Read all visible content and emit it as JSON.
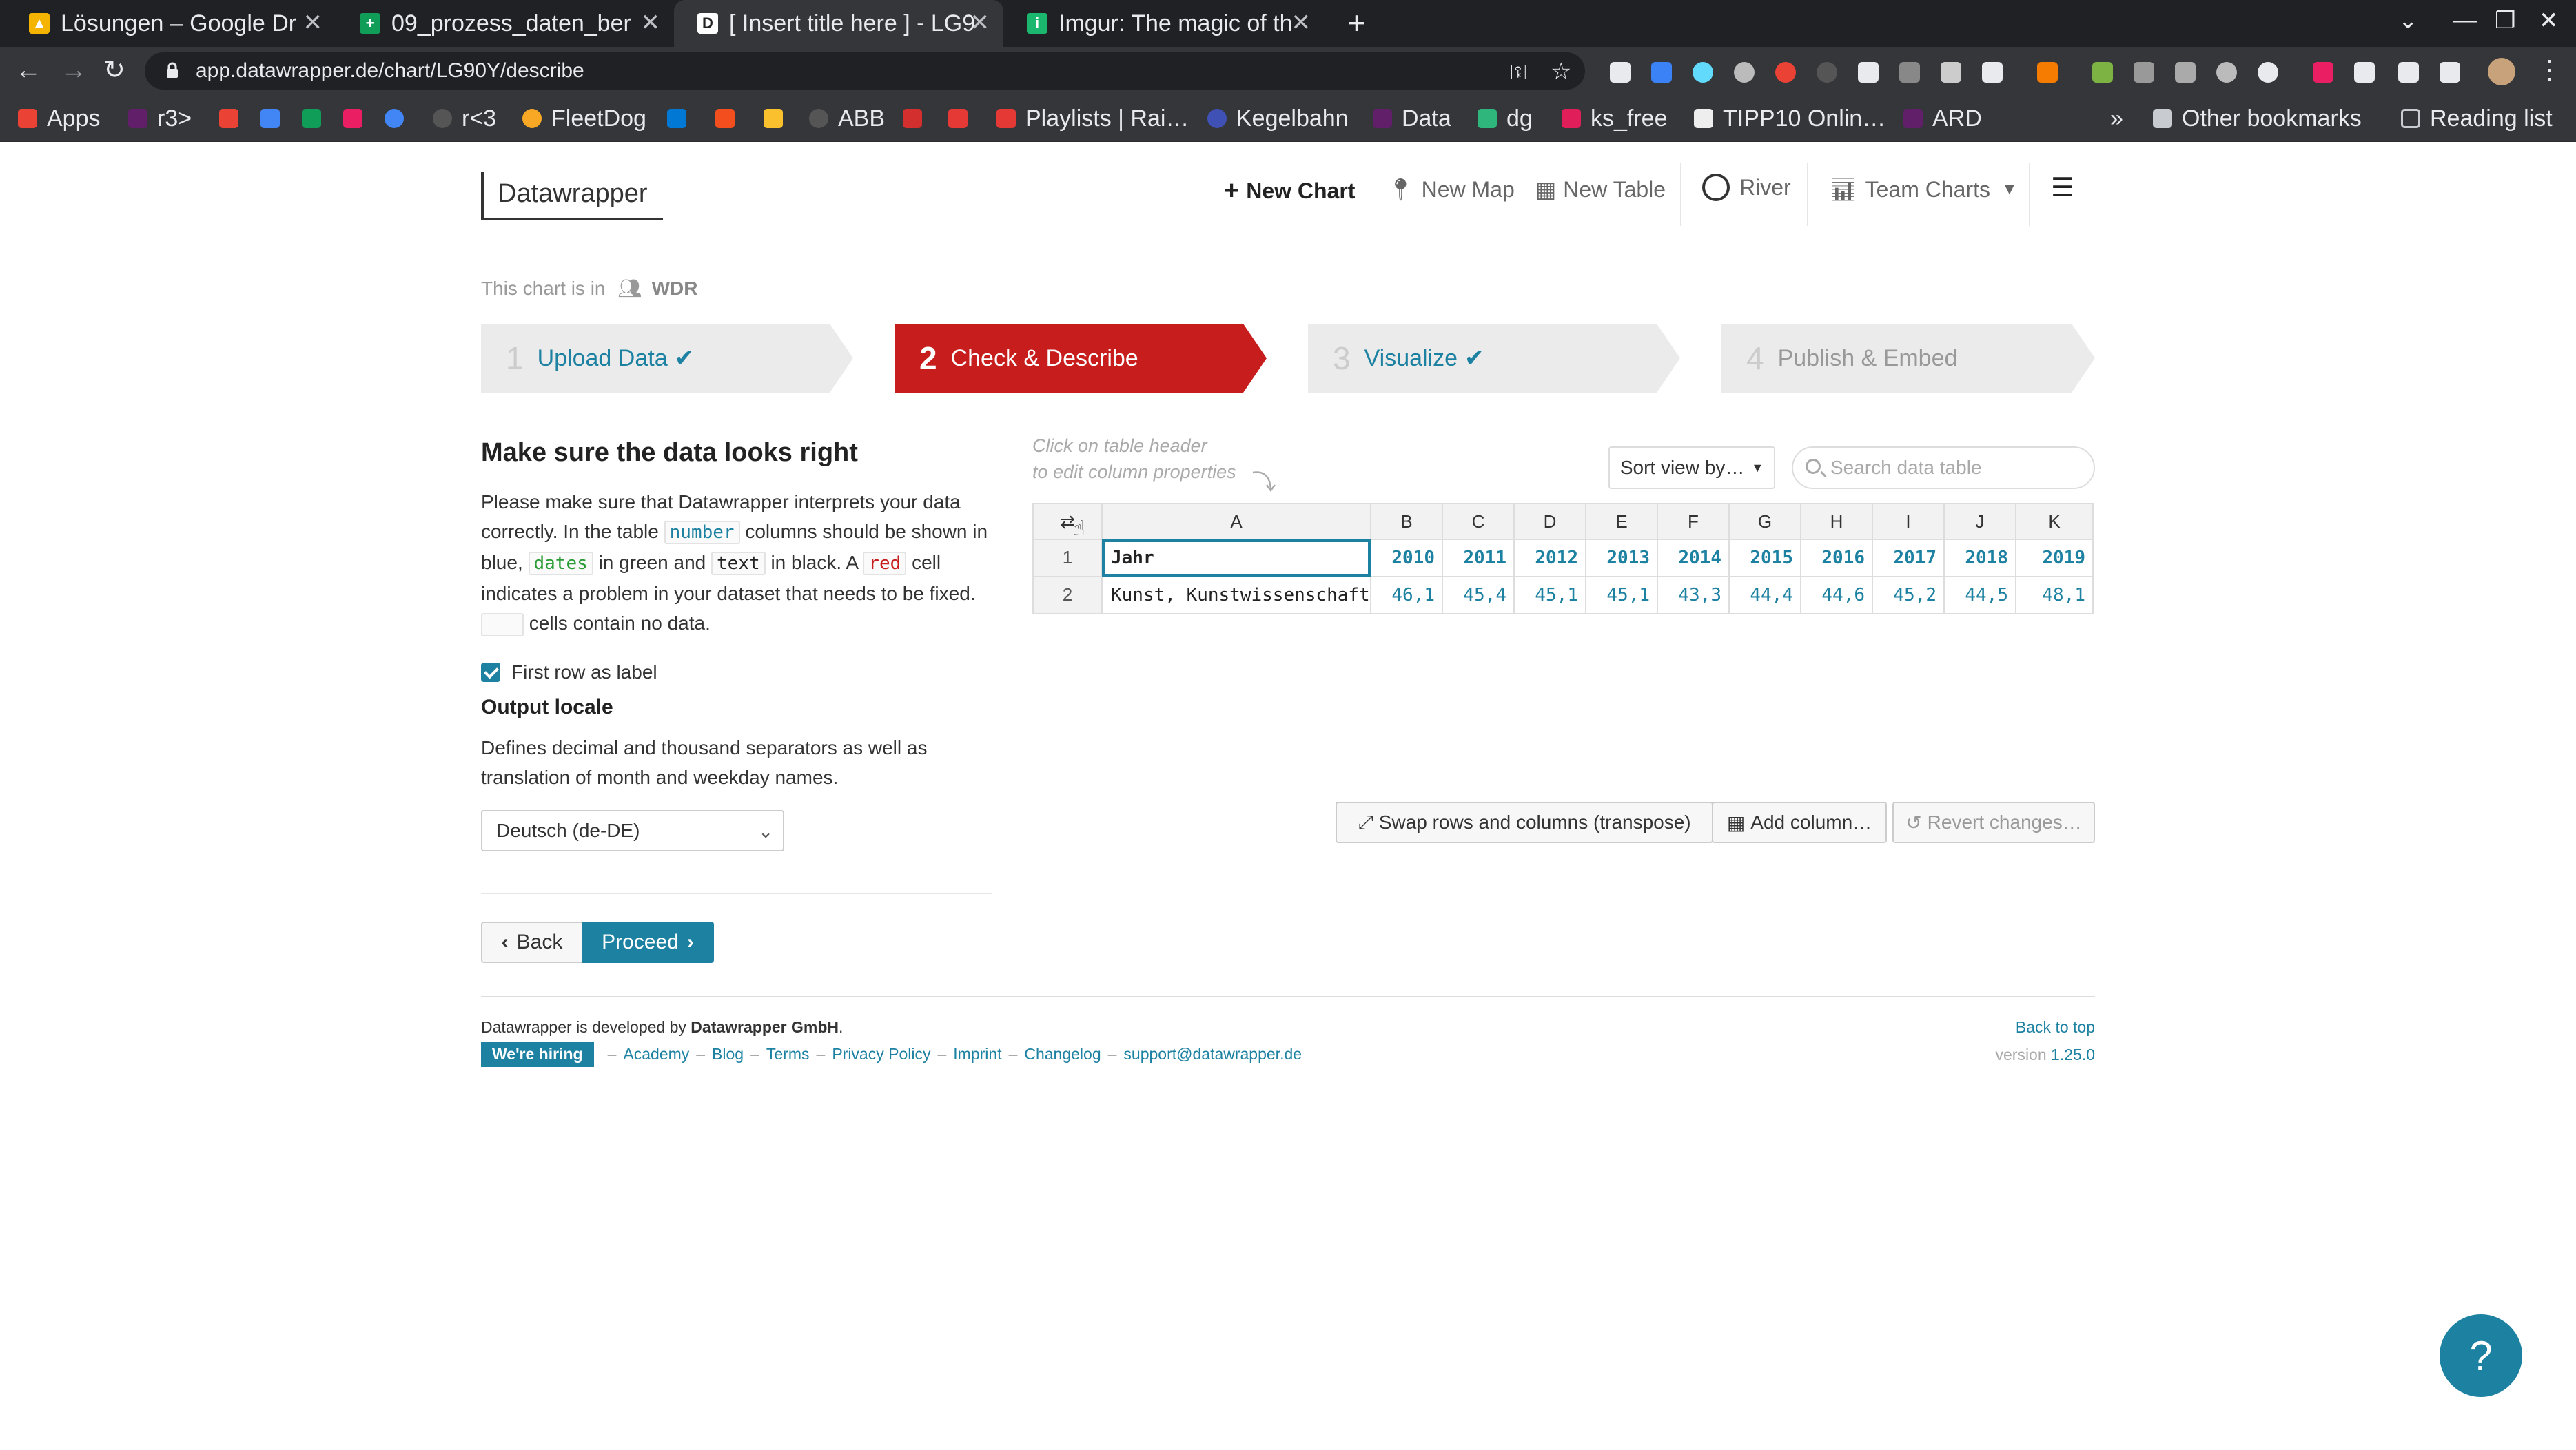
{
  "browser": {
    "tabs": [
      {
        "title": "Lösungen – Google Dr",
        "icon": "google-drive-icon",
        "color": "#f4b400"
      },
      {
        "title": "09_prozess_daten_ber",
        "icon": "google-sheets-icon",
        "color": "#0f9d58"
      },
      {
        "title": "[ Insert title here ] - LG9",
        "icon": "datawrapper-icon",
        "color": "#222222"
      },
      {
        "title": "Imgur: The magic of th",
        "icon": "imgur-icon",
        "color": "#1bb76e"
      }
    ],
    "url": "app.datawrapper.de/chart/LG90Y/describe",
    "bookmarks": [
      "Apps",
      "r3>",
      "r<3",
      "FleetDog",
      "ABB",
      "Playlists | Rai…",
      "Kegelbahn",
      "Data",
      "dg",
      "ks_free",
      "TIPP10 Onlin…",
      "ARD"
    ],
    "other_bookmarks": "Other bookmarks",
    "reading_list": "Reading list"
  },
  "nav": {
    "logo": "Datawrapper",
    "new_chart": "New Chart",
    "new_map": "New Map",
    "new_table": "New Table",
    "river": "River",
    "team_charts": "Team Charts"
  },
  "org": {
    "prefix": "This chart is in",
    "name": "WDR"
  },
  "steps": [
    {
      "num": "1",
      "label": "Upload Data",
      "done": true
    },
    {
      "num": "2",
      "label": "Check & Describe",
      "active": true
    },
    {
      "num": "3",
      "label": "Visualize",
      "done": true
    },
    {
      "num": "4",
      "label": "Publish & Embed"
    }
  ],
  "left": {
    "heading": "Make sure the data looks right",
    "intro_1": "Please make sure that Datawrapper interprets your data correctly. In the table",
    "code_number": "number",
    "intro_2": "columns should be shown in blue,",
    "code_dates": "dates",
    "intro_3": "in green and",
    "code_text": "text",
    "intro_4": "in black. A",
    "code_red": "red",
    "intro_5": "cell indicates a problem in your dataset that needs to be fixed.",
    "intro_6": "cells contain no data.",
    "first_row_label": "First row as label",
    "locale_heading": "Output locale",
    "locale_desc": "Defines decimal and thousand separators as well as translation of month and weekday names.",
    "locale_value": "Deutsch (de-DE)",
    "back": "Back",
    "proceed": "Proceed"
  },
  "table": {
    "hint_1": "Click on table header",
    "hint_2": "to edit column properties",
    "sort_label": "Sort view by…",
    "search_placeholder": "Search data table",
    "columns": [
      "A",
      "B",
      "C",
      "D",
      "E",
      "F",
      "G",
      "H",
      "I",
      "J",
      "K"
    ],
    "row1_label": "Jahr",
    "row1_values": [
      "2010",
      "2011",
      "2012",
      "2013",
      "2014",
      "2015",
      "2016",
      "2017",
      "2018",
      "2019"
    ],
    "row2_label": "Kunst, Kunstwissenschaft",
    "row2_values": [
      "46,1",
      "45,4",
      "45,1",
      "45,1",
      "43,3",
      "44,4",
      "44,6",
      "45,2",
      "44,5",
      "48,1"
    ],
    "swap": "Swap rows and columns (transpose)",
    "add_column": "Add column…",
    "revert": "Revert changes…"
  },
  "footer": {
    "credit_pre": "Datawrapper is developed by",
    "credit_name": "Datawrapper GmbH",
    "hiring": "We're hiring",
    "links": [
      "Academy",
      "Blog",
      "Terms",
      "Privacy Policy",
      "Imprint",
      "Changelog",
      "support@datawrapper.de"
    ],
    "back_top": "Back to top",
    "version_label": "version",
    "version": "1.25.0"
  },
  "help": "?"
}
